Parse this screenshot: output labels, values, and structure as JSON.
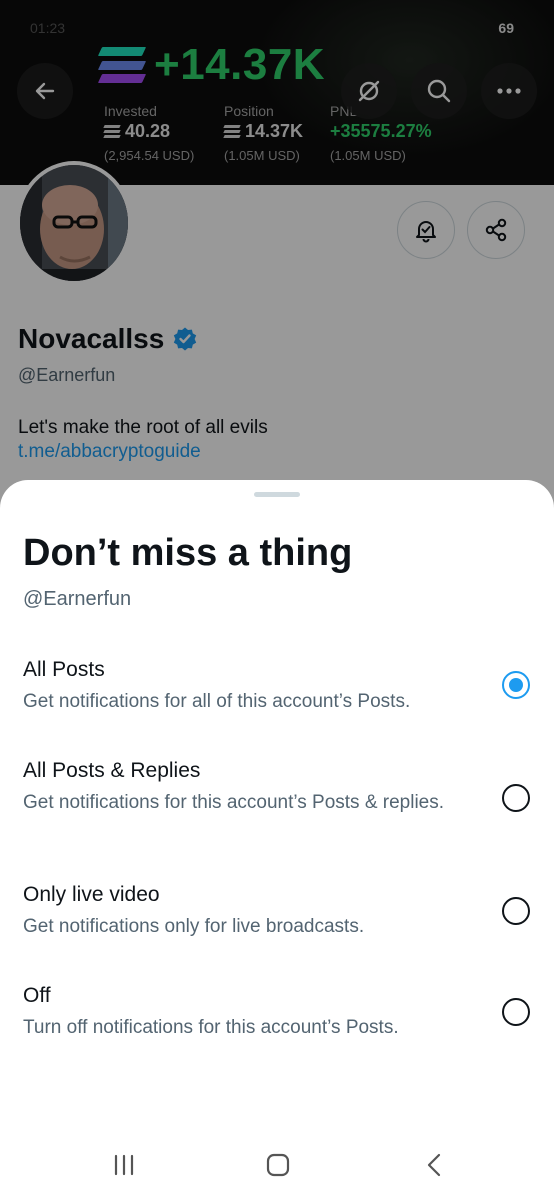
{
  "status": {
    "left": "01:23",
    "battery": "69"
  },
  "banner": {
    "amount": "+14.37K",
    "stats": [
      {
        "label": "Invested",
        "value": "40.28",
        "sub": "(2,954.54 USD)"
      },
      {
        "label": "Position",
        "value": "14.37K",
        "sub": "(1.05M USD)"
      },
      {
        "label": "PNL",
        "value": "+35575.27%",
        "sub": "(1.05M USD)"
      }
    ],
    "colors": {
      "positive": "#2fd26b"
    }
  },
  "icons": {
    "back": "arrow-left-icon",
    "grok": "grok-icon",
    "search": "search-icon",
    "more": "more-icon",
    "bell": "notification-bell-icon",
    "share": "share-icon",
    "verified": "verified-badge-icon"
  },
  "profile": {
    "name": "Novacallss",
    "handle": "@Earnerfun",
    "bio": "Let's make the root of all evils",
    "link": "t.me/abbacryptoguide"
  },
  "sheet": {
    "title": "Don’t miss a thing",
    "handle": "@Earnerfun",
    "options": [
      {
        "title": "All Posts",
        "desc": "Get notifications for all of this account’s Posts.",
        "selected": true
      },
      {
        "title": "All Posts & Replies",
        "desc": "Get notifications for this account’s Posts & replies.",
        "selected": false
      },
      {
        "title": "Only live video",
        "desc": "Get notifications only for live broadcasts.",
        "selected": false
      },
      {
        "title": "Off",
        "desc": "Turn off notifications for this account’s Posts.",
        "selected": false
      }
    ],
    "accent": "#1d9bf0"
  }
}
